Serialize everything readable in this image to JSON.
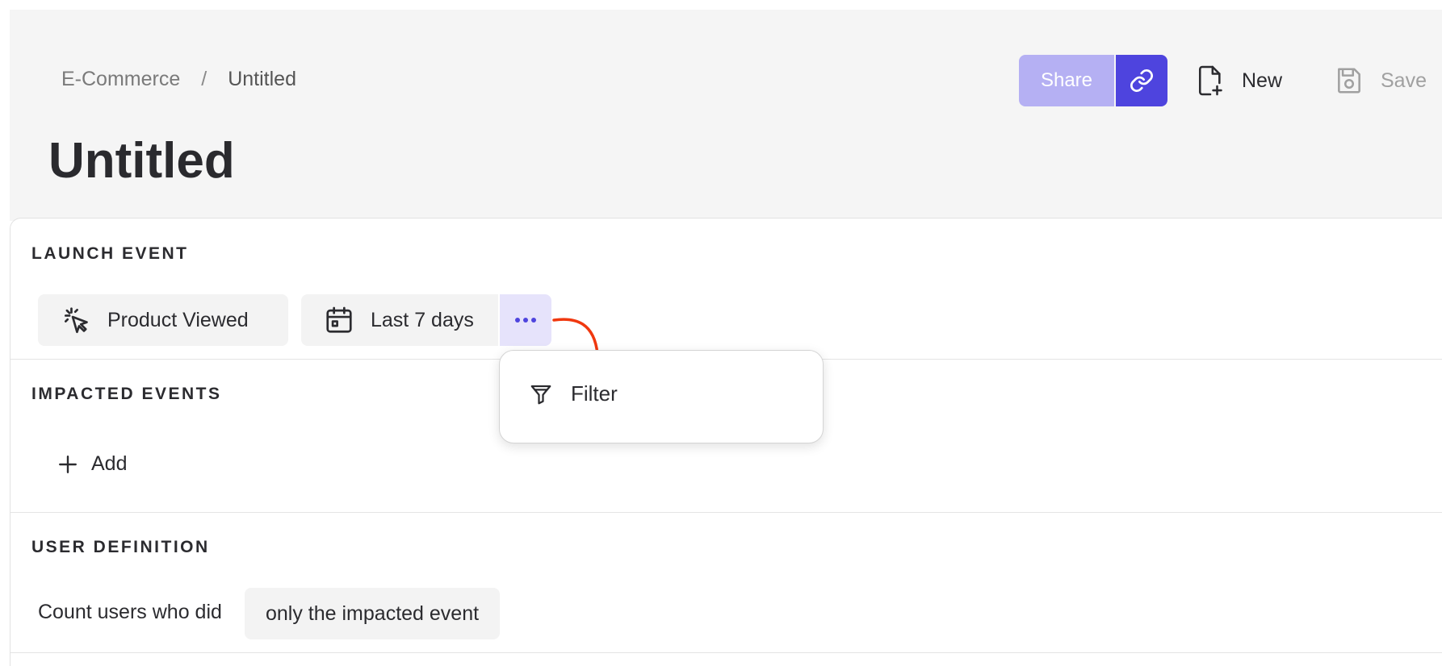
{
  "breadcrumb": {
    "parent": "E-Commerce",
    "separator": "/",
    "current": "Untitled"
  },
  "page": {
    "title": "Untitled"
  },
  "toolbar": {
    "share_label": "Share",
    "new_label": "New",
    "save_label": "Save"
  },
  "sections": {
    "launch_event": {
      "title": "LAUNCH EVENT",
      "event_label": "Product Viewed",
      "date_range_label": "Last 7 days"
    },
    "impacted_events": {
      "title": "IMPACTED EVENTS",
      "add_label": "Add"
    },
    "user_definition": {
      "title": "USER DEFINITION",
      "count_label": "Count users who did",
      "mode_value": "only the impacted event"
    }
  },
  "menu": {
    "items": [
      {
        "label": "Filter",
        "icon": "filter-icon"
      }
    ]
  },
  "colors": {
    "accent": "#4e44de",
    "accent_light": "#b5b0f3",
    "arrow": "#f0380f",
    "header_bg": "#f5f5f5"
  }
}
